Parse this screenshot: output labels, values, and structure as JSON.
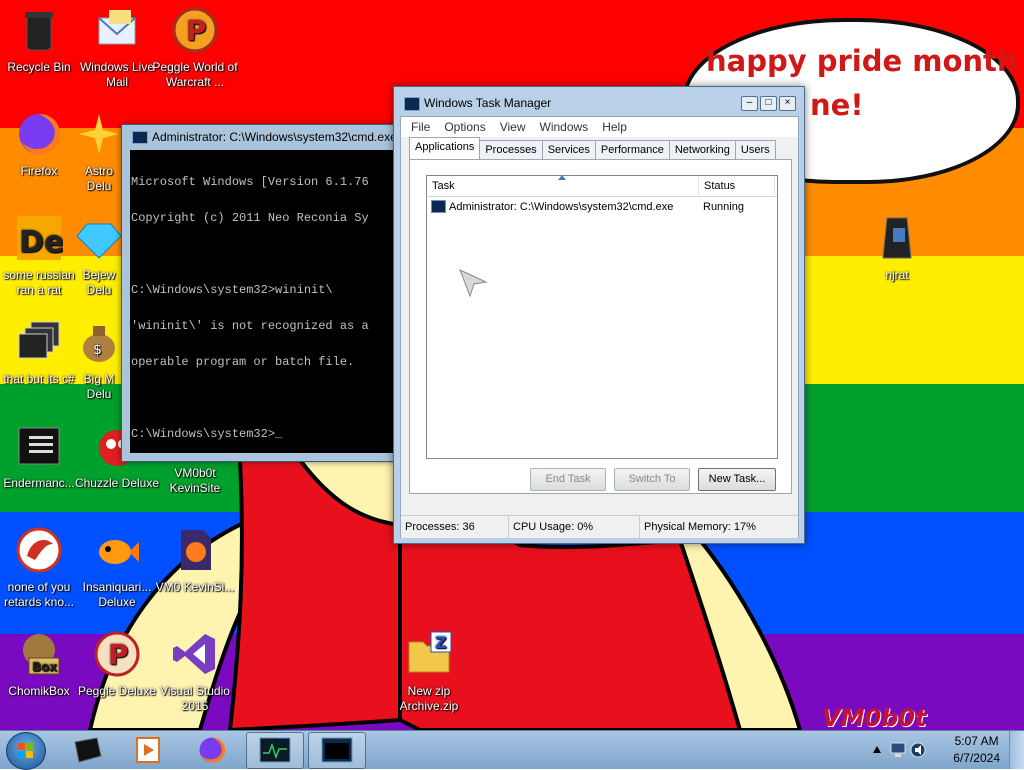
{
  "colors": {
    "red": "#ff0000",
    "orange": "#ff8c00",
    "yellow": "#ffee00",
    "green": "#00a02c",
    "blue": "#0050ff",
    "purple": "#7a0ac0",
    "bubble_text": "#d01818"
  },
  "wallpaper": {
    "bubble_line1": "happy pride month",
    "bubble_line2": "ne!",
    "watermark": "VM0b0t"
  },
  "desktop_icons": [
    {
      "label": "Recycle Bin",
      "icon": "recycle-bin-icon"
    },
    {
      "label": "Windows Live Mail",
      "icon": "mail-icon"
    },
    {
      "label": "Peggle World of Warcraft ...",
      "icon": "peggle-icon"
    },
    {
      "label": "Firefox",
      "icon": "firefox-icon"
    },
    {
      "label": "Astro Delu",
      "icon": "astro-icon"
    },
    {
      "label": "some russian ran a rat",
      "icon": "de-icon"
    },
    {
      "label": "Bejew Delu",
      "icon": "gem-icon"
    },
    {
      "label": "that but its c#",
      "icon": "windows-stack-icon"
    },
    {
      "label": "Big M Delu",
      "icon": "money-bag-icon"
    },
    {
      "label": "Endermanc...",
      "icon": "console-icon"
    },
    {
      "label": "Chuzzle Deluxe",
      "icon": "chuzzle-icon"
    },
    {
      "label": "VM0b0t KevinSite",
      "icon": "document-icon"
    },
    {
      "label": "none of you retards kno...",
      "icon": "dragon-icon"
    },
    {
      "label": "Insaniquari... Deluxe",
      "icon": "fish-icon"
    },
    {
      "label": "VM0 KevinSi...",
      "icon": "firefox-file-icon"
    },
    {
      "label": "ChomikBox",
      "icon": "hamster-box-icon"
    },
    {
      "label": "Peggle Deluxe",
      "icon": "peggle-icon"
    },
    {
      "label": "Visual Studio 2015",
      "icon": "visual-studio-icon"
    },
    {
      "label": "New zip Archive.zip",
      "icon": "zip-folder-icon"
    },
    {
      "label": "njrat",
      "icon": "njrat-icon"
    }
  ],
  "cmd": {
    "title": "Administrator: C:\\Windows\\system32\\cmd.exe",
    "lines": [
      "Microsoft Windows [Version 6.1.76",
      "Copyright (c) 2011 Neo Reconia Sy",
      "",
      "C:\\Windows\\system32>wininit\\",
      "'wininit\\' is not recognized as a",
      "operable program or batch file.",
      "",
      "C:\\Windows\\system32>_"
    ]
  },
  "taskmgr": {
    "title": "Windows Task Manager",
    "menu": [
      "File",
      "Options",
      "View",
      "Windows",
      "Help"
    ],
    "tabs": [
      "Applications",
      "Processes",
      "Services",
      "Performance",
      "Networking",
      "Users"
    ],
    "columns": [
      "Task",
      "Status"
    ],
    "rows": [
      {
        "task": "Administrator: C:\\Windows\\system32\\cmd.exe",
        "status": "Running"
      }
    ],
    "buttons": {
      "end_task": "End Task",
      "switch_to": "Switch To",
      "new_task": "New Task..."
    },
    "status": {
      "processes": "Processes: 36",
      "cpu": "CPU Usage: 0%",
      "memory": "Physical Memory: 17%"
    }
  },
  "taskbar": {
    "items": [
      "cmd-window-icon",
      "media-player-icon",
      "firefox-icon",
      "task-manager-icon",
      "cmd-icon"
    ],
    "time": "5:07 AM",
    "date": "6/7/2024"
  }
}
